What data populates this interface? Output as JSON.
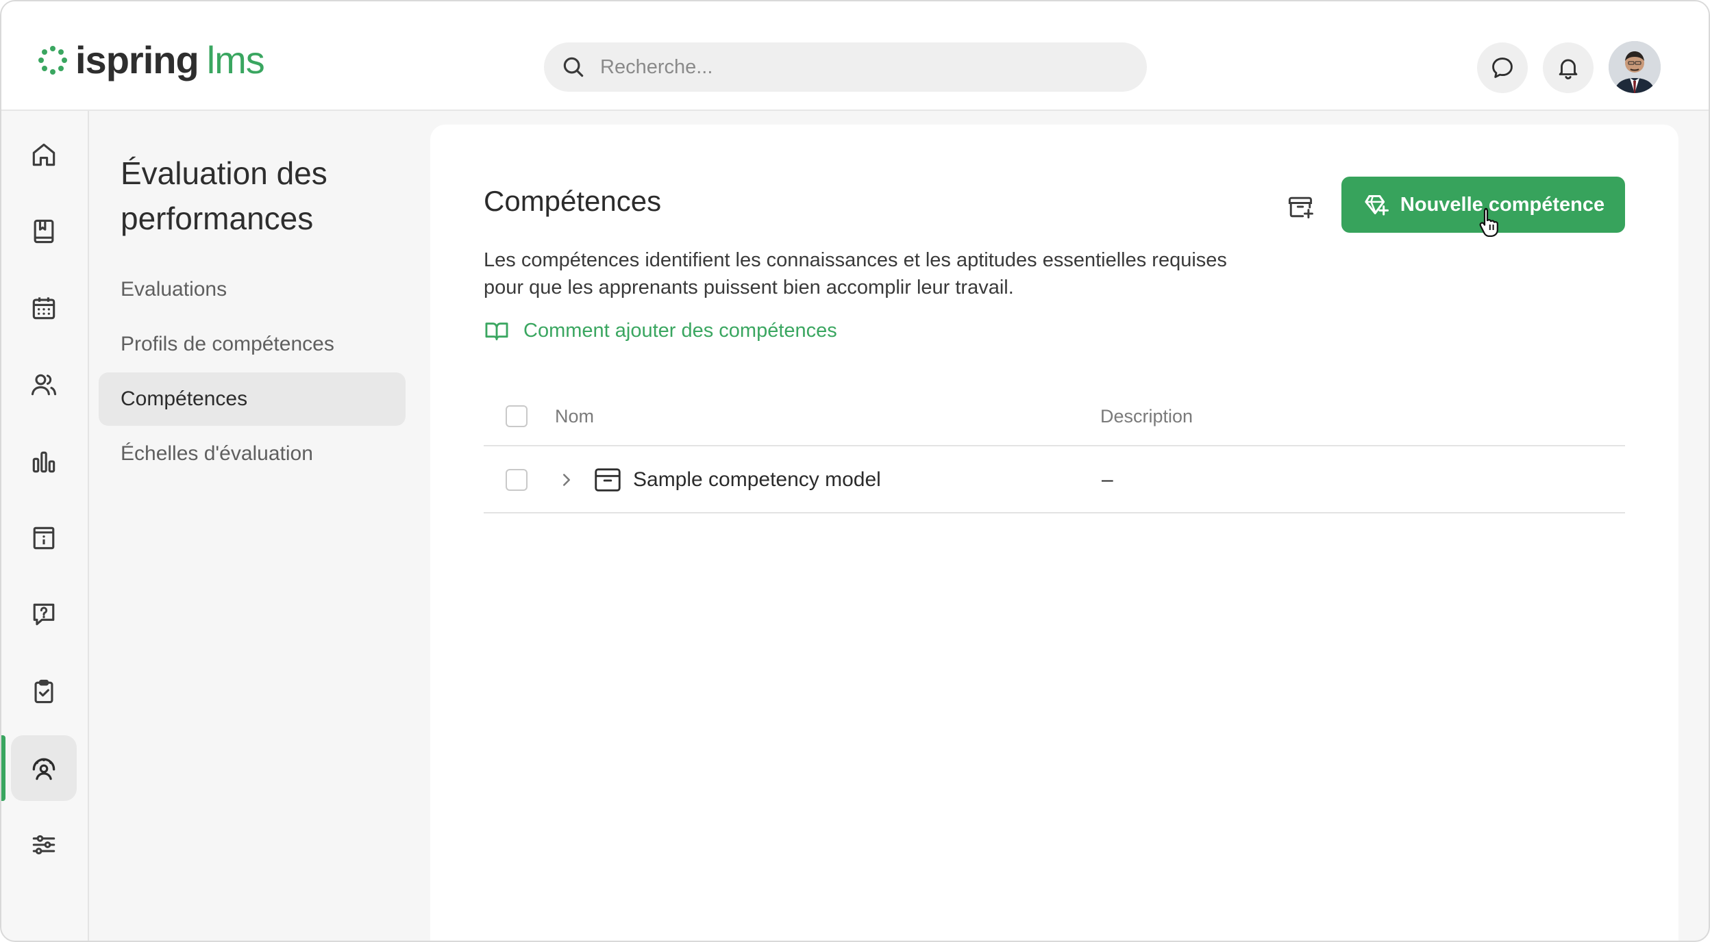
{
  "header": {
    "logo": {
      "word1": "ispring",
      "word2": "lms"
    },
    "search": {
      "placeholder": "Recherche..."
    },
    "icons": [
      "chat-icon",
      "bell-icon"
    ]
  },
  "rail": {
    "items": [
      "home-icon",
      "book-icon",
      "calendar-icon",
      "users-icon",
      "chart-icon",
      "info-board-icon",
      "question-icon",
      "clipboard-check-icon",
      "performance-icon",
      "sliders-icon"
    ],
    "active": "performance-icon"
  },
  "section": {
    "title": "Évaluation des performances",
    "nav": [
      {
        "label": "Evaluations"
      },
      {
        "label": "Profils de compétences"
      },
      {
        "label": "Compétences",
        "active": true
      },
      {
        "label": "Échelles d'évaluation"
      }
    ]
  },
  "main": {
    "title": "Compétences",
    "description": "Les compétences identifient les connaissances et les aptitudes essentielles requises pour que les apprenants puissent bien accomplir leur travail.",
    "help_link": "Comment ajouter des compétences",
    "new_button": "Nouvelle compétence",
    "table": {
      "columns": [
        "Nom",
        "Description"
      ],
      "rows": [
        {
          "name": "Sample competency model",
          "description": "–"
        }
      ]
    }
  },
  "colors": {
    "accent": "#37a35c",
    "text": "#2b2b2b",
    "muted": "#7a7a7a"
  }
}
